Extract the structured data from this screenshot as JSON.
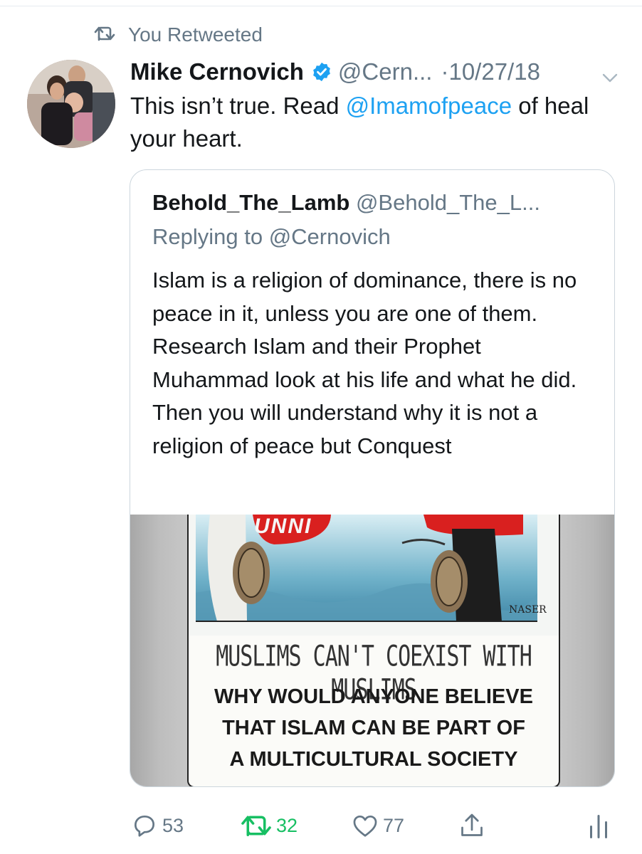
{
  "retweet_banner": {
    "label": "You Retweeted"
  },
  "tweet": {
    "author_name": "Mike Cernovich",
    "author_handle": "@Cern...",
    "separator": "·",
    "date": "10/27/18",
    "text_before": "This isn’t true. Read ",
    "mention": "@Imamofpeace",
    "text_after": " of heal your heart."
  },
  "quoted_tweet": {
    "author_name": "Behold_The_Lamb",
    "author_handle": "@Behold_The_L...",
    "replying_to": "Replying to @Cernovich",
    "text": "Islam is a religion of dominance, there is no peace in it, unless you are one of them. Research Islam and their Prophet Muhammad look at his life and what he did. Then you will understand why it is not a religion of peace but Conquest",
    "media": {
      "top_partial_text": "UNNI",
      "artist_signature": "NASER",
      "banner_line": "MUSLIMS CAN'T COEXIST WITH MUSLIMS",
      "body_lines": [
        "WHY WOULD ANYONE BELIEVE",
        "THAT ISLAM CAN BE PART OF",
        "A MULTICULTURAL SOCIETY"
      ]
    }
  },
  "actions": {
    "reply_count": "53",
    "retweet_count": "32",
    "like_count": "77"
  },
  "colors": {
    "accent": "#1da1f2",
    "retweeted": "#17bf63",
    "muted": "#657786"
  },
  "icons": [
    "retweet-icon",
    "verified-badge-icon",
    "chevron-down-icon",
    "reply-icon",
    "like-icon",
    "share-icon",
    "analytics-icon"
  ]
}
